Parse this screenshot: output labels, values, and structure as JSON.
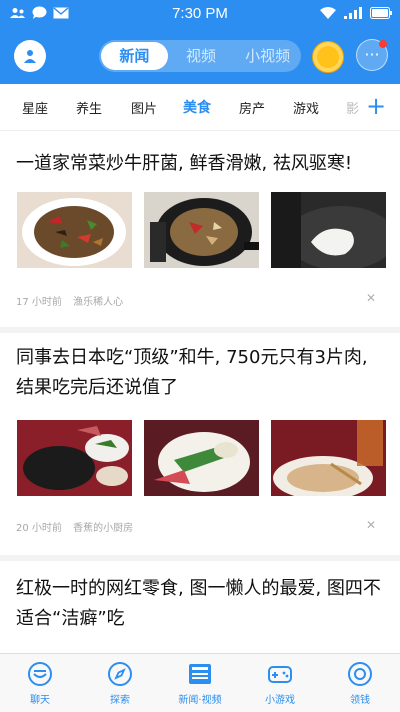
{
  "status_bar": {
    "time": "7:30 PM"
  },
  "header": {
    "segments": [
      {
        "label": "新闻",
        "active": true
      },
      {
        "label": "视频",
        "active": false
      },
      {
        "label": "小视频",
        "active": false
      }
    ]
  },
  "categories": [
    {
      "label": "星座"
    },
    {
      "label": "养生"
    },
    {
      "label": "图片"
    },
    {
      "label": "美食",
      "active": true
    },
    {
      "label": "房产"
    },
    {
      "label": "游戏"
    },
    {
      "label": "影"
    }
  ],
  "articles": [
    {
      "title": "一道家常菜炒牛肝菌, 鲜香滑嫩, 祛风驱寒!",
      "time": "17 小时前",
      "source": "渔乐稀人心"
    },
    {
      "title": "同事去日本吃“顶级”和牛, 750元只有3片肉, 结果吃完后还说值了",
      "time": "20 小时前",
      "source": "香蕉的小厨房"
    },
    {
      "title": "红极一时的网红零食, 图一懒人的最爱, 图四不适合“洁癖”吃"
    }
  ],
  "bottom_nav": [
    {
      "label": "聊天",
      "icon": "chat-bubble-icon"
    },
    {
      "label": "探索",
      "icon": "compass-icon"
    },
    {
      "label": "新闻·视频",
      "icon": "news-icon"
    },
    {
      "label": "小游戏",
      "icon": "gamepad-icon"
    },
    {
      "label": "领钱",
      "icon": "coin-icon"
    }
  ],
  "colors": {
    "brand_blue": "#2b8ef0",
    "badge_red": "#ff3b30",
    "coin_gold": "#ffc21a"
  }
}
